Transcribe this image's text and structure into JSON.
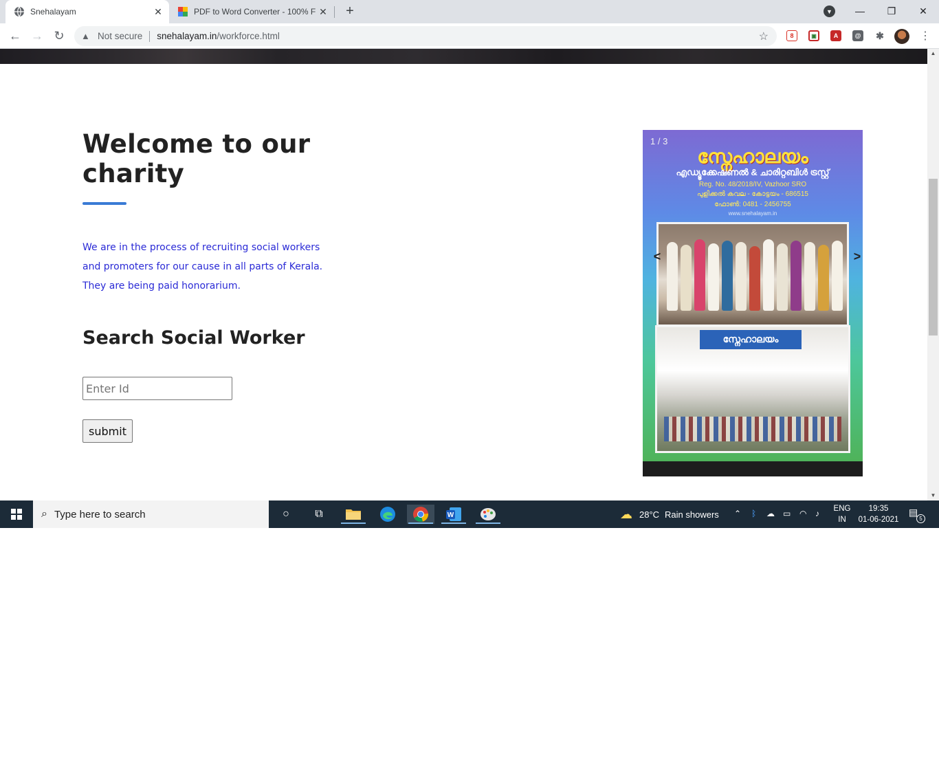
{
  "browser": {
    "tabs": [
      {
        "title": "Snehalayam",
        "active": true
      },
      {
        "title": "PDF to Word Converter - 100% F",
        "active": false
      }
    ],
    "new_tab": "+",
    "address": {
      "security": "Not secure",
      "domain": "snehalayam.in",
      "path": "/workforce.html"
    },
    "window_controls": {
      "minimize": "—",
      "restore": "❐",
      "close": "✕"
    }
  },
  "page": {
    "heading": "Welcome to our charity",
    "intro": "We are in the process of recruiting social workers and promoters for our cause in all parts of Kerala. They are being paid honorarium.",
    "search_heading": "Search Social Worker",
    "id_placeholder": "Enter Id",
    "submit_label": "submit",
    "slideshow": {
      "counter": "1 / 3",
      "prev": "<",
      "next": ">",
      "title": "സ്നേഹാലയം",
      "subtitle": "എഡ്യൂക്കേഷണൽ & ചാരിറ്റബിൾ ട്രസ്റ്റ്",
      "reg": "Reg. No. 48/2018/IV, Vazhoor SRO",
      "address": "പുളിക്കൽ കവല - കോട്ടയം - 686515",
      "phone": "ഫോൺ: 0481 - 2456755",
      "web": "www.snehalayam.in",
      "sign": "സ്നേഹാലയം"
    }
  },
  "taskbar": {
    "search_placeholder": "Type here to search",
    "weather": {
      "temp": "28°C",
      "condition": "Rain showers"
    },
    "lang": {
      "line1": "ENG",
      "line2": "IN"
    },
    "time": "19:35",
    "date": "01-06-2021",
    "notifications": "5"
  },
  "colors": {
    "accent": "#3a7bd5",
    "intro_text": "#2a2ad6",
    "taskbar": "#1c2b38"
  }
}
